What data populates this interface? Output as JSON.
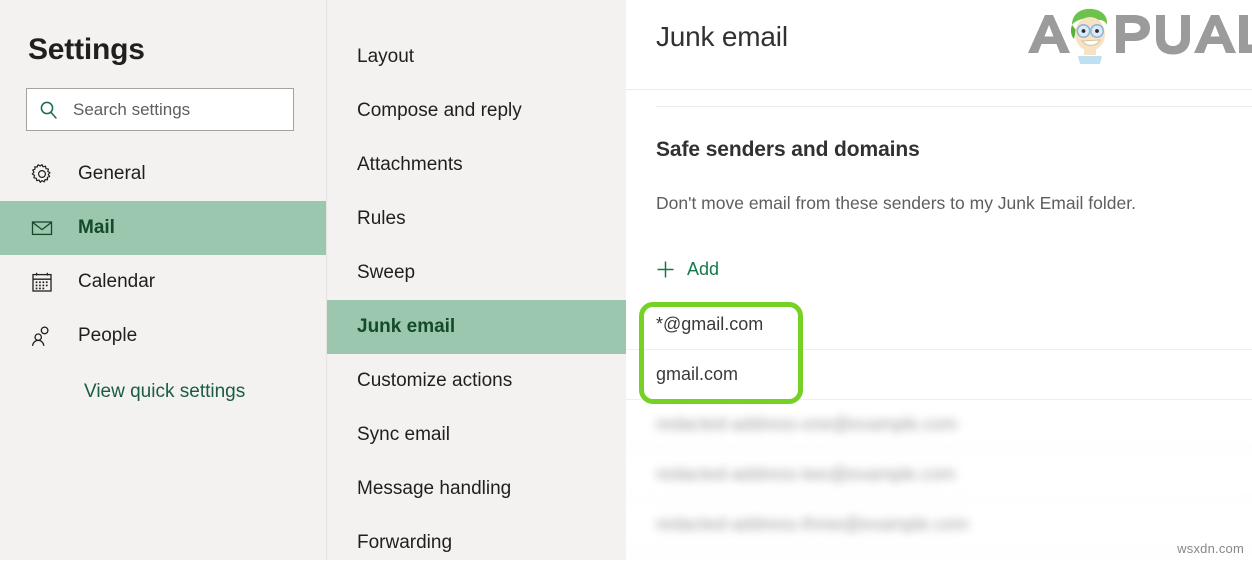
{
  "settings_pane": {
    "title": "Settings",
    "search": {
      "placeholder": "Search settings",
      "value": "",
      "icon": "search-icon"
    },
    "items": [
      {
        "label": "General",
        "icon": "gear-icon",
        "selected": false
      },
      {
        "label": "Mail",
        "icon": "envelope-icon",
        "selected": true
      },
      {
        "label": "Calendar",
        "icon": "calendar-icon",
        "selected": false
      },
      {
        "label": "People",
        "icon": "people-icon",
        "selected": false
      }
    ],
    "quick_settings_link": "View quick settings"
  },
  "sub_pane": {
    "items": [
      {
        "label": "Layout",
        "selected": false
      },
      {
        "label": "Compose and reply",
        "selected": false
      },
      {
        "label": "Attachments",
        "selected": false
      },
      {
        "label": "Rules",
        "selected": false
      },
      {
        "label": "Sweep",
        "selected": false
      },
      {
        "label": "Junk email",
        "selected": true
      },
      {
        "label": "Customize actions",
        "selected": false
      },
      {
        "label": "Sync email",
        "selected": false
      },
      {
        "label": "Message handling",
        "selected": false
      },
      {
        "label": "Forwarding",
        "selected": false
      }
    ]
  },
  "content": {
    "page_title": "Junk email",
    "section_heading": "Safe senders and domains",
    "section_description": "Don't move email from these senders to my Junk Email folder.",
    "add_button": {
      "label": "Add",
      "icon": "plus-icon"
    },
    "sender_rows": [
      {
        "value": "*@gmail.com",
        "blurred": false
      },
      {
        "value": "gmail.com",
        "blurred": false
      },
      {
        "value": "redacted-address-one@example.com",
        "blurred": true
      },
      {
        "value": "redacted-address-two@example.com",
        "blurred": true
      },
      {
        "value": "redacted-address-three@example.com",
        "blurred": true
      }
    ],
    "callout": {
      "shape": "rounded-rectangle",
      "color": "#76d127"
    }
  },
  "branding": {
    "logo_text_left": "A",
    "logo_text_right": "PUALS",
    "logo_color": "#9b9b9b",
    "logo_hair_color": "#6cc24a"
  },
  "watermark": "wsxdn.com",
  "colors": {
    "pane_background": "#f3f2f1",
    "selected_item_background": "#9ac7ad",
    "selected_item_text": "#14492c",
    "accent_green": "#13794a",
    "callout_green": "#76d127",
    "body_text": "#201f1e",
    "muted_text": "#605e5c"
  }
}
